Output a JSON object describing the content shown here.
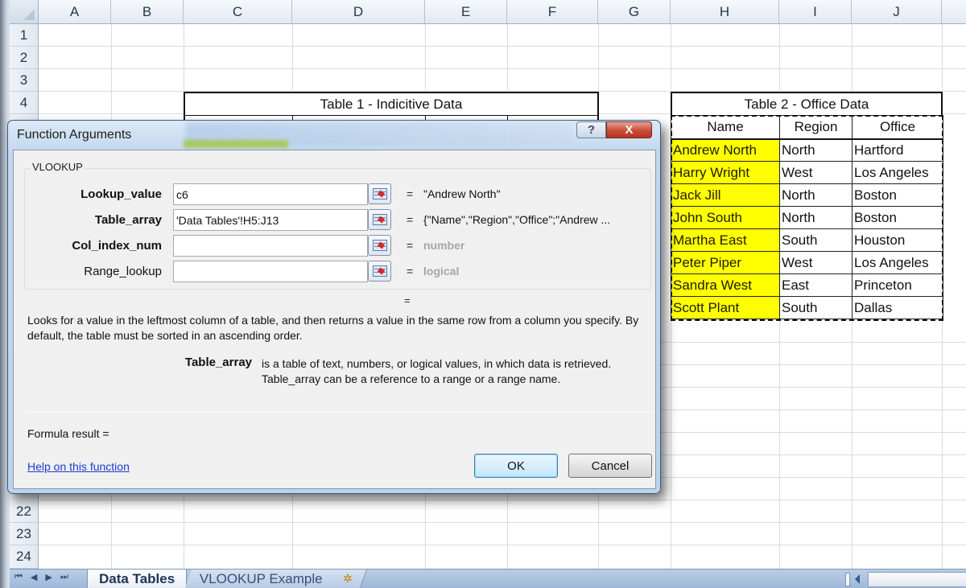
{
  "spreadsheet": {
    "columns": [
      "A",
      "B",
      "C",
      "D",
      "E",
      "F",
      "G",
      "H",
      "I",
      "J"
    ],
    "visible_rows_top": [
      "1",
      "2",
      "3",
      "4"
    ],
    "visible_rows_bottom": [
      "22",
      "23",
      "24"
    ],
    "table1": {
      "title": "Table 1 - Indicitive Data"
    },
    "table2": {
      "title": "Table 2 - Office Data",
      "headers": [
        "Name",
        "Region",
        "Office"
      ],
      "rows": [
        [
          "Andrew North",
          "North",
          "Hartford"
        ],
        [
          "Harry Wright",
          "West",
          "Los Angeles"
        ],
        [
          "Jack Jill",
          "North",
          "Boston"
        ],
        [
          "John South",
          "North",
          "Boston"
        ],
        [
          "Martha East",
          "South",
          "Houston"
        ],
        [
          "Peter Piper",
          "West",
          "Los Angeles"
        ],
        [
          "Sandra West",
          "East",
          "Princeton"
        ],
        [
          "Scott Plant",
          "South",
          "Dallas"
        ]
      ],
      "highlight_color": "#ffff00"
    }
  },
  "sheet_tabs": {
    "nav": [
      "first-sheet",
      "previous-sheet",
      "next-sheet",
      "last-sheet"
    ],
    "nav_glyphs": [
      "⏮",
      "◀",
      "▶",
      "⏭"
    ],
    "tabs": [
      "Data Tables",
      "VLOOKUP Example"
    ],
    "active_tab": "Data Tables",
    "insert_sheet_icon": "insert-worksheet-icon"
  },
  "dialog": {
    "title": "Function Arguments",
    "help_glyph": "?",
    "close_glyph": "X",
    "function_name": "VLOOKUP",
    "arguments": [
      {
        "label": "Lookup_value",
        "bold": true,
        "value": "c6",
        "result": "\"Andrew North\"",
        "hint": false
      },
      {
        "label": "Table_array",
        "bold": true,
        "value": "'Data Tables'!H5:J13",
        "result": "{\"Name\",\"Region\",\"Office\";\"Andrew ...",
        "hint": false
      },
      {
        "label": "Col_index_num",
        "bold": true,
        "value": "",
        "result": "number",
        "hint": true
      },
      {
        "label": "Range_lookup",
        "bold": false,
        "value": "",
        "result": "logical",
        "hint": true
      }
    ],
    "equals": "=",
    "description": "Looks for a value in the leftmost column of a table, and then returns a value in the same row from a column you specify. By default, the table must be sorted in an ascending order.",
    "param_name": "Table_array",
    "param_description": "is a table of text, numbers, or logical values, in which data is retrieved. Table_array can be a reference to a range or a range name.",
    "formula_result_label": "Formula result =",
    "help_link": "Help on this function",
    "ok_label": "OK",
    "cancel_label": "Cancel"
  }
}
